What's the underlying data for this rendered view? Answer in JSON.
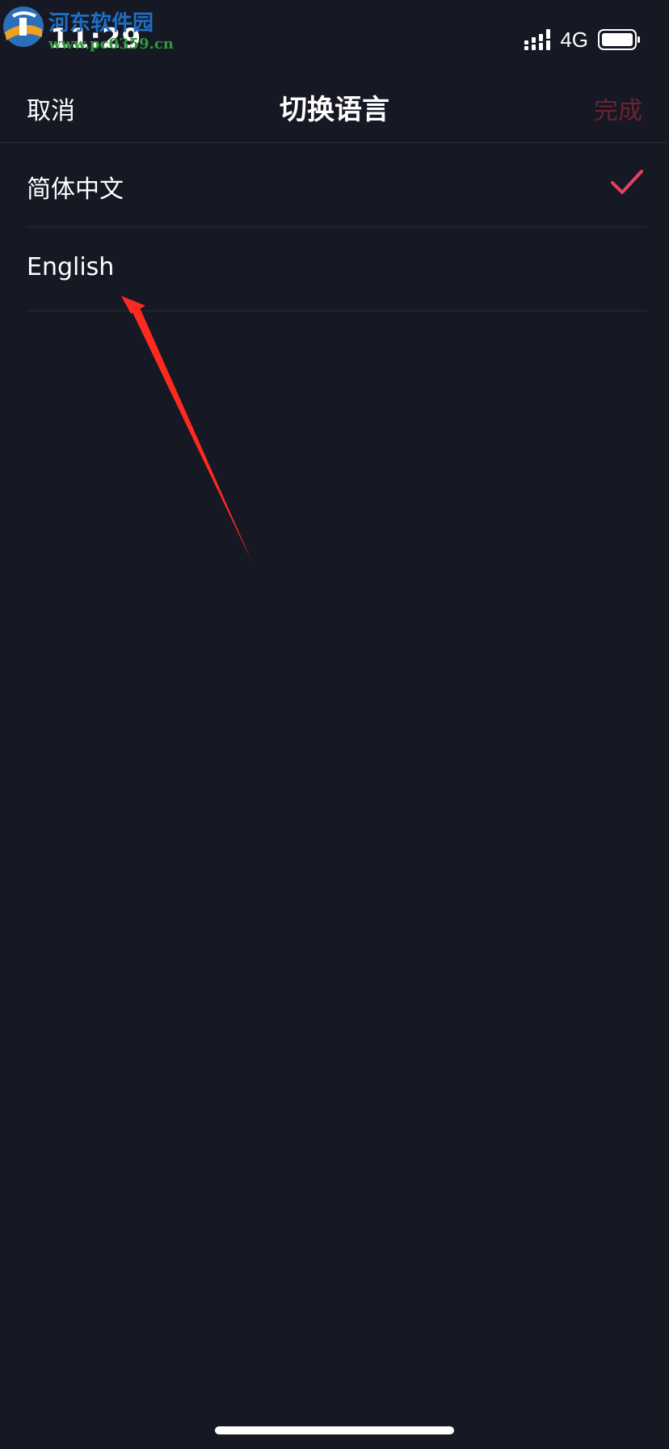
{
  "status_bar": {
    "time": "11:29",
    "network": "4G"
  },
  "watermark": {
    "title": "河东软件园",
    "url": "www.pc0359.cn"
  },
  "nav": {
    "cancel_label": "取消",
    "title": "切换语言",
    "done_label": "完成"
  },
  "languages": {
    "items": [
      {
        "label": "简体中文",
        "selected": true
      },
      {
        "label": "English",
        "selected": false
      }
    ]
  },
  "colors": {
    "background": "#161824",
    "accent": "#e8405f",
    "done_disabled": "#6a2433",
    "divider": "#2a2c38",
    "annotation_arrow": "#ff2a1f"
  },
  "icons": {
    "check": "check-icon",
    "signal": "signal-icon",
    "battery": "battery-icon"
  }
}
